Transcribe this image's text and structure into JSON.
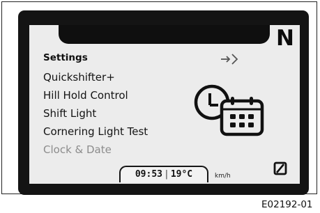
{
  "display": {
    "gear": "N",
    "menu": {
      "title": "Settings",
      "items": [
        {
          "label": "Quickshifter+",
          "state": "normal"
        },
        {
          "label": "Hill Hold Control",
          "state": "normal"
        },
        {
          "label": "Shift Light",
          "state": "normal"
        },
        {
          "label": "Cornering Light Test",
          "state": "normal"
        },
        {
          "label": "Clock & Date",
          "state": "highlighted"
        }
      ]
    },
    "status": {
      "time": "09:53",
      "separator": "|",
      "temperature": "19°C",
      "speed_unit": "km/h"
    },
    "icons": {
      "enter": "enter-arrow-icon",
      "clock_calendar": "clock-calendar-icon",
      "trip": "trip-reset-icon"
    }
  },
  "figure": {
    "code": "E02192-01"
  },
  "colors": {
    "bezel": "#141414",
    "screen": "#ececec",
    "text": "#141414",
    "dim_text": "#8c8c8c"
  }
}
